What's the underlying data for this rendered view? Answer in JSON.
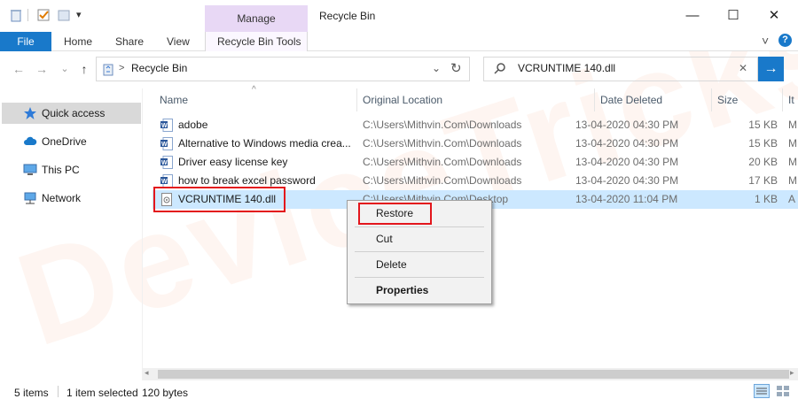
{
  "window": {
    "title": "Recycle Bin",
    "contextual_group": "Manage",
    "minimize": "—",
    "maximize": "☐",
    "close": "✕"
  },
  "ribbon": {
    "tabs": [
      "File",
      "Home",
      "Share",
      "View",
      "Recycle Bin Tools"
    ],
    "collapse_icon": "˅",
    "help_icon": "?"
  },
  "nav_buttons": {
    "back": "←",
    "forward": "→",
    "up_dropdown": "⌄",
    "up": "↑"
  },
  "address": {
    "path_separator": ">",
    "location": "Recycle Bin",
    "dropdown": "⌄",
    "refresh": "↻"
  },
  "search": {
    "value": "VCRUNTIME 140.dll",
    "clear": "✕",
    "go": "→"
  },
  "sidebar": {
    "items": [
      {
        "label": "Quick access",
        "icon": "star-icon",
        "selected": true
      },
      {
        "label": "OneDrive",
        "icon": "cloud-icon"
      },
      {
        "label": "This PC",
        "icon": "computer-icon"
      },
      {
        "label": "Network",
        "icon": "network-icon"
      }
    ]
  },
  "list": {
    "columns": [
      "Name",
      "Original Location",
      "Date Deleted",
      "Size",
      "It"
    ],
    "sort_indicator": "^",
    "rows": [
      {
        "name": "adobe",
        "location": "C:\\Users\\Mithvin.Com\\Downloads",
        "date": "13-04-2020 04:30 PM",
        "size": "15 KB",
        "type": "M",
        "icon": "word-doc-icon"
      },
      {
        "name": "Alternative to Windows media crea...",
        "location": "C:\\Users\\Mithvin.Com\\Downloads",
        "date": "13-04-2020 04:30 PM",
        "size": "15 KB",
        "type": "M",
        "icon": "word-doc-icon"
      },
      {
        "name": "Driver easy license key",
        "location": "C:\\Users\\Mithvin.Com\\Downloads",
        "date": "13-04-2020 04:30 PM",
        "size": "20 KB",
        "type": "M",
        "icon": "word-doc-icon"
      },
      {
        "name": "how to break excel password",
        "location": "C:\\Users\\Mithvin.Com\\Downloads",
        "date": "13-04-2020 04:30 PM",
        "size": "17 KB",
        "type": "M",
        "icon": "word-doc-icon"
      },
      {
        "name": "VCRUNTIME 140.dll",
        "location": "C:\\Users\\Mithvin.Com\\Desktop",
        "date": "13-04-2020 11:04 PM",
        "size": "1 KB",
        "type": "A",
        "icon": "dll-file-icon",
        "selected": true
      }
    ]
  },
  "context_menu": {
    "items": [
      "Restore",
      "Cut",
      "Delete",
      "Properties"
    ]
  },
  "status": {
    "count": "5 items",
    "selection": "1 item selected",
    "size": "120 bytes"
  },
  "watermark": "DeviceTricks",
  "colors": {
    "accent": "#1979ca",
    "manage_tab": "#e8d8f5",
    "selection": "#cce8ff",
    "highlight_box": "#e3161c"
  }
}
